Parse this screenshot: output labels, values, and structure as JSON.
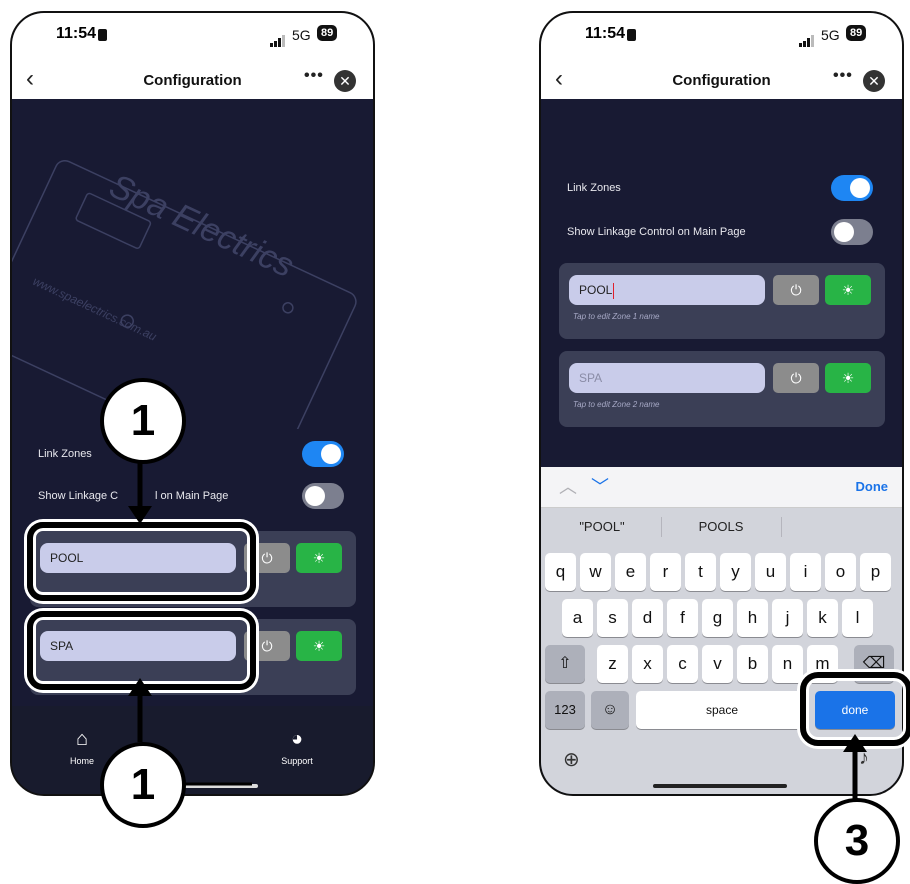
{
  "status": {
    "time": "11:54",
    "network": "5G",
    "battery": "89"
  },
  "navbar": {
    "back_icon": "chevron-left-icon",
    "title": "Configuration",
    "more": "•••",
    "close": "✕"
  },
  "settings": {
    "link_zones": "Link Zones",
    "show_linkage": "Show Linkage Control on Main Page",
    "show_linkage_partial_a": "Show Linkage C",
    "show_linkage_partial_b": "l on Main Page"
  },
  "watermark": {
    "brand": "Spa Electrics",
    "url": "www.spaelectrics.com.au"
  },
  "zones": [
    {
      "name": "POOL",
      "hint": "Tap to edit Zone 1 name"
    },
    {
      "name": "SPA",
      "hint": "Tap to edit Zone 2 name"
    }
  ],
  "tabs": [
    {
      "label": "Home",
      "label_partial": "Home"
    },
    {
      "label": "Support"
    }
  ],
  "keyboard": {
    "toolbar_done": "Done",
    "suggestions": [
      "\"POOL\"",
      "POOLS"
    ],
    "row1": [
      "q",
      "w",
      "e",
      "r",
      "t",
      "y",
      "u",
      "i",
      "o",
      "p"
    ],
    "row2": [
      "a",
      "s",
      "d",
      "f",
      "g",
      "h",
      "j",
      "k",
      "l"
    ],
    "row3": [
      "z",
      "x",
      "c",
      "v",
      "b",
      "n",
      "m"
    ],
    "key_123": "123",
    "space": "space",
    "done": "done"
  },
  "callouts": [
    "1",
    "1",
    "3"
  ],
  "colors": {
    "accent_blue": "#1e86f3",
    "light_green": "#28b446",
    "background": "#181a33"
  }
}
